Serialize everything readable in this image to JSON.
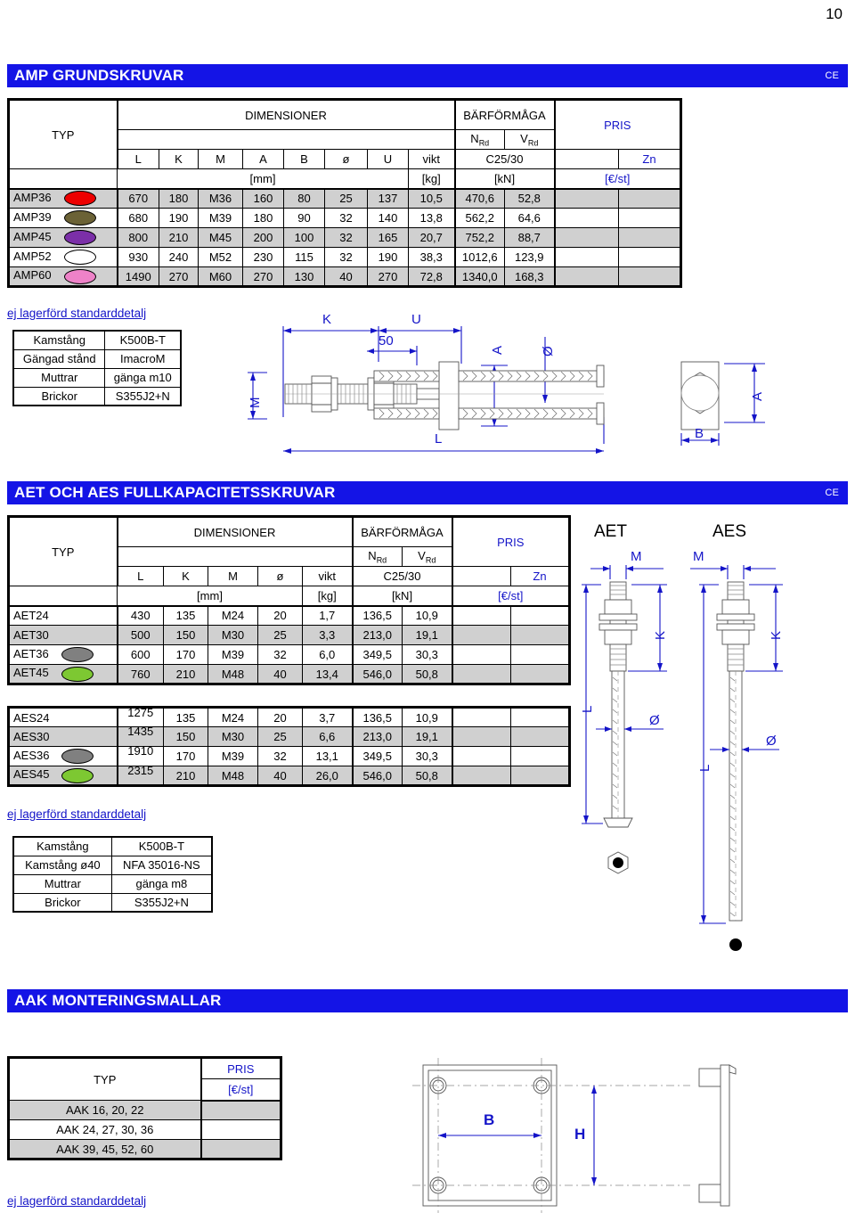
{
  "page": {
    "number": "10"
  },
  "common": {
    "ce": "CE",
    "note": "ej lagerförd standarddetalj",
    "headers": {
      "typ": "TYP",
      "dimensioner": "DIMENSIONER",
      "barformaga": "BÄRFÖRMÅGA",
      "pris": "PRIS",
      "nrd": "N",
      "nrd_sub": "Rd",
      "vrd": "V",
      "vrd_sub": "Rd",
      "vikt": "vikt",
      "concrete": "C25/30",
      "zn": "Zn",
      "mm": "[mm]",
      "kg": "[kg]",
      "kn": "[kN]",
      "eur": "[€/st]",
      "L": "L",
      "K": "K",
      "M": "M",
      "A": "A",
      "B": "B",
      "diam": "ø",
      "U": "U"
    }
  },
  "section_amp": {
    "title": "AMP GRUNDSKRUVAR",
    "columns": [
      "L",
      "K",
      "M",
      "A",
      "B",
      "ø",
      "U"
    ],
    "rows": [
      {
        "typ": "AMP36",
        "color": "#EE0000",
        "L": "670",
        "K": "180",
        "M": "M36",
        "A": "160",
        "B": "80",
        "diam": "25",
        "U": "137",
        "vikt": "10,5",
        "nrd": "470,6",
        "vrd": "52,8"
      },
      {
        "typ": "AMP39",
        "color": "#6B6236",
        "L": "680",
        "K": "190",
        "M": "M39",
        "A": "180",
        "B": "90",
        "diam": "32",
        "U": "140",
        "vikt": "13,8",
        "nrd": "562,2",
        "vrd": "64,6"
      },
      {
        "typ": "AMP45",
        "color": "#7B2FA8",
        "L": "800",
        "K": "210",
        "M": "M45",
        "A": "200",
        "B": "100",
        "diam": "32",
        "U": "165",
        "vikt": "20,7",
        "nrd": "752,2",
        "vrd": "88,7"
      },
      {
        "typ": "AMP52",
        "color": "#FFFFFF",
        "L": "930",
        "K": "240",
        "M": "M52",
        "A": "230",
        "B": "115",
        "diam": "32",
        "U": "190",
        "vikt": "38,3",
        "nrd": "1012,6",
        "vrd": "123,9"
      },
      {
        "typ": "AMP60",
        "color": "#EE82C8",
        "L": "1490",
        "K": "270",
        "M": "M60",
        "A": "270",
        "B": "130",
        "diam": "40",
        "U": "270",
        "vikt": "72,8",
        "nrd": "1340,0",
        "vrd": "168,3"
      }
    ],
    "materials": [
      {
        "item": "Kamstång",
        "spec": "K500B-T"
      },
      {
        "item": "Gängad stånd",
        "spec": "ImacroM"
      },
      {
        "item": "Muttrar",
        "spec": "gänga m10"
      },
      {
        "item": "Brickor",
        "spec": "S355J2+N"
      }
    ],
    "drawing_labels": {
      "K": "K",
      "U": "U",
      "fifty": "50",
      "A": "A",
      "diam": "Ø",
      "M": "M",
      "L": "L",
      "A2": "A",
      "B": "B"
    }
  },
  "section_aet": {
    "title": "AET OCH AES FULLKAPACITETSSKRUVAR",
    "columns": [
      "L",
      "K",
      "M",
      "ø"
    ],
    "rows_aet": [
      {
        "typ": "AET24",
        "color": null,
        "L": "430",
        "K": "135",
        "M": "M24",
        "diam": "20",
        "vikt": "1,7",
        "nrd": "136,5",
        "vrd": "10,9"
      },
      {
        "typ": "AET30",
        "color": null,
        "L": "500",
        "K": "150",
        "M": "M30",
        "diam": "25",
        "vikt": "3,3",
        "nrd": "213,0",
        "vrd": "19,1"
      },
      {
        "typ": "AET36",
        "color": "#808080",
        "L": "600",
        "K": "170",
        "M": "M39",
        "diam": "32",
        "vikt": "6,0",
        "nrd": "349,5",
        "vrd": "30,3"
      },
      {
        "typ": "AET45",
        "color": "#7DC832",
        "L": "760",
        "K": "210",
        "M": "M48",
        "diam": "40",
        "vikt": "13,4",
        "nrd": "546,0",
        "vrd": "50,8"
      }
    ],
    "rows_aes": [
      {
        "typ": "AES24",
        "color": null,
        "L": "1275",
        "K": "135",
        "M": "M24",
        "diam": "20",
        "vikt": "3,7",
        "nrd": "136,5",
        "vrd": "10,9"
      },
      {
        "typ": "AES30",
        "color": null,
        "L": "1435",
        "K": "150",
        "M": "M30",
        "diam": "25",
        "vikt": "6,6",
        "nrd": "213,0",
        "vrd": "19,1"
      },
      {
        "typ": "AES36",
        "color": "#808080",
        "L": "1910",
        "K": "170",
        "M": "M39",
        "diam": "32",
        "vikt": "13,1",
        "nrd": "349,5",
        "vrd": "30,3"
      },
      {
        "typ": "AES45",
        "color": "#7DC832",
        "L": "2315",
        "K": "210",
        "M": "M48",
        "diam": "40",
        "vikt": "26,0",
        "nrd": "546,0",
        "vrd": "50,8"
      }
    ],
    "materials": [
      {
        "item": "Kamstång",
        "spec": "K500B-T"
      },
      {
        "item": "Kamstång ø40",
        "spec": "NFA 35016-NS"
      },
      {
        "item": "Muttrar",
        "spec": "gänga m8"
      },
      {
        "item": "Brickor",
        "spec": "S355J2+N"
      }
    ],
    "drawing_labels": {
      "aet_title": "AET",
      "aes_title": "AES",
      "aet_M": "M",
      "aet_K": "K",
      "aet_L": "L",
      "aet_diam": "Ø",
      "aes_M": "M",
      "aes_K": "K",
      "aes_L": "L",
      "aes_diam": "Ø"
    }
  },
  "section_aak": {
    "title": "AAK MONTERINGSMALLAR",
    "header_typ": "TYP",
    "header_pris": "PRIS",
    "header_eur": "[€/st]",
    "rows": [
      {
        "typ": "AAK 16, 20, 22"
      },
      {
        "typ": "AAK 24, 27, 30, 36"
      },
      {
        "typ": "AAK 39, 45, 52, 60"
      }
    ],
    "drawing_labels": {
      "B": "B",
      "H": "H"
    }
  }
}
